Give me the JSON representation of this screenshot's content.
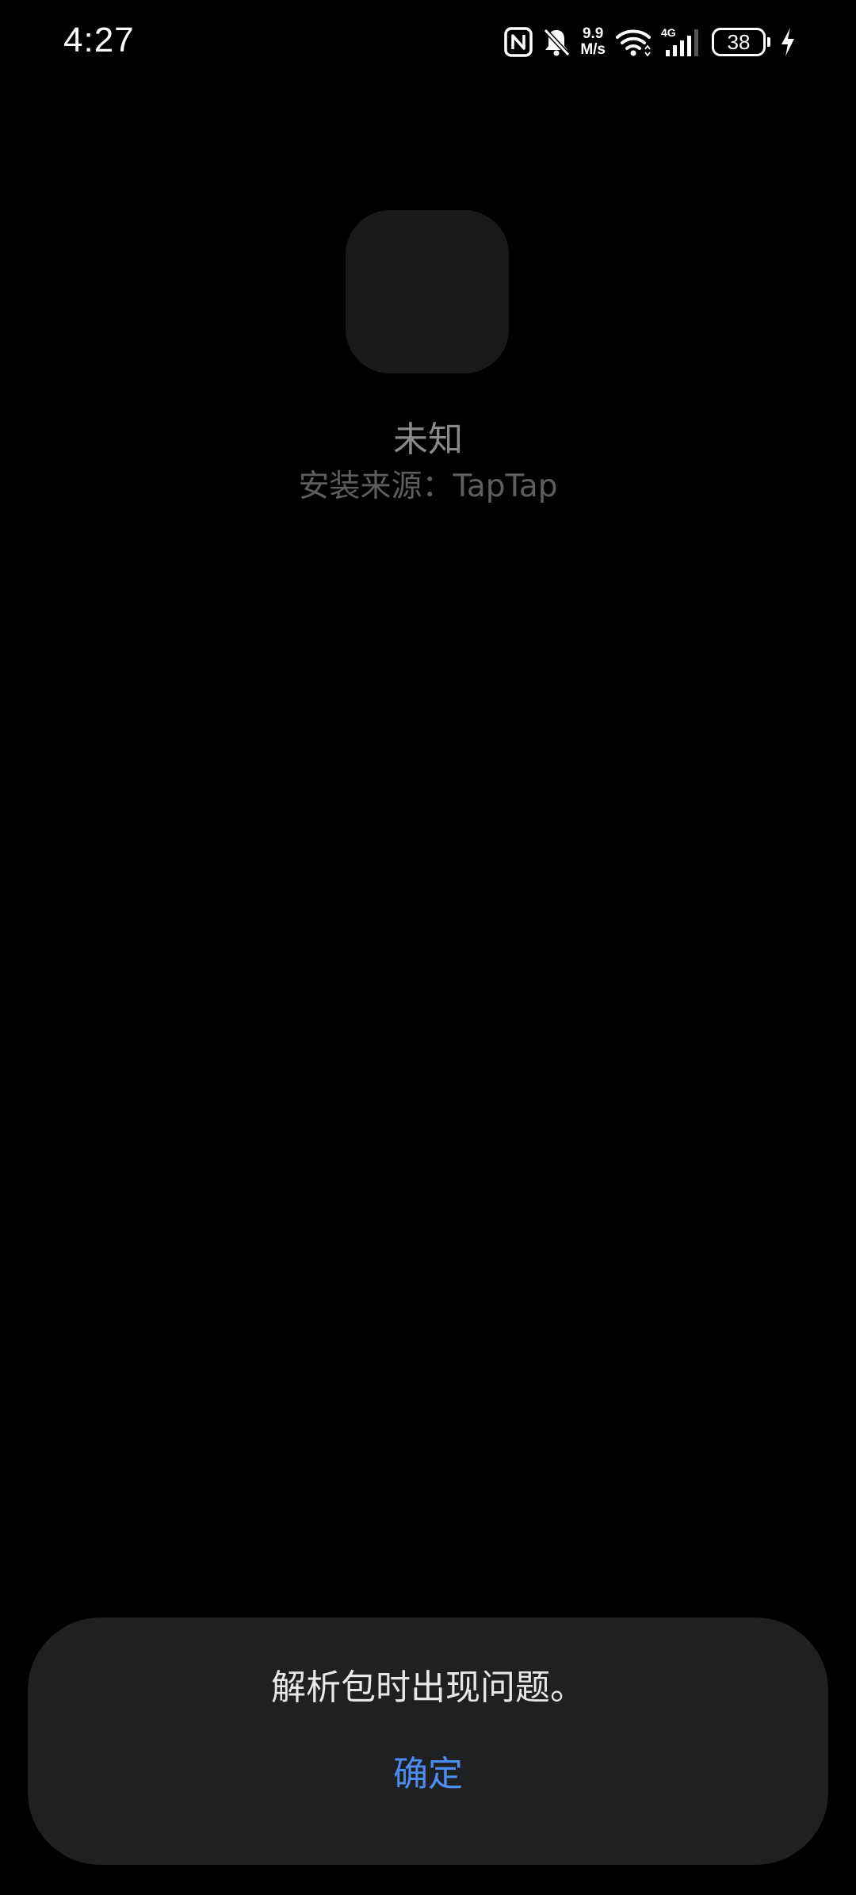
{
  "status_bar": {
    "time": "4:27",
    "net_speed_value": "9.9",
    "net_speed_unit": "M/s",
    "network_type": "4G",
    "battery_level": "38",
    "icons": [
      "nfc-icon",
      "mute-bell-icon",
      "wifi-icon",
      "signal-icon",
      "battery-icon",
      "charging-icon"
    ]
  },
  "app": {
    "name": "未知",
    "install_source": "安装来源：TapTap"
  },
  "dialog": {
    "message": "解析包时出现问题。",
    "confirm_label": "确定"
  },
  "colors": {
    "background": "#000000",
    "app_icon_placeholder": "#1a1a1a",
    "dialog_background": "#1f2022",
    "accent": "#4d8df2"
  }
}
